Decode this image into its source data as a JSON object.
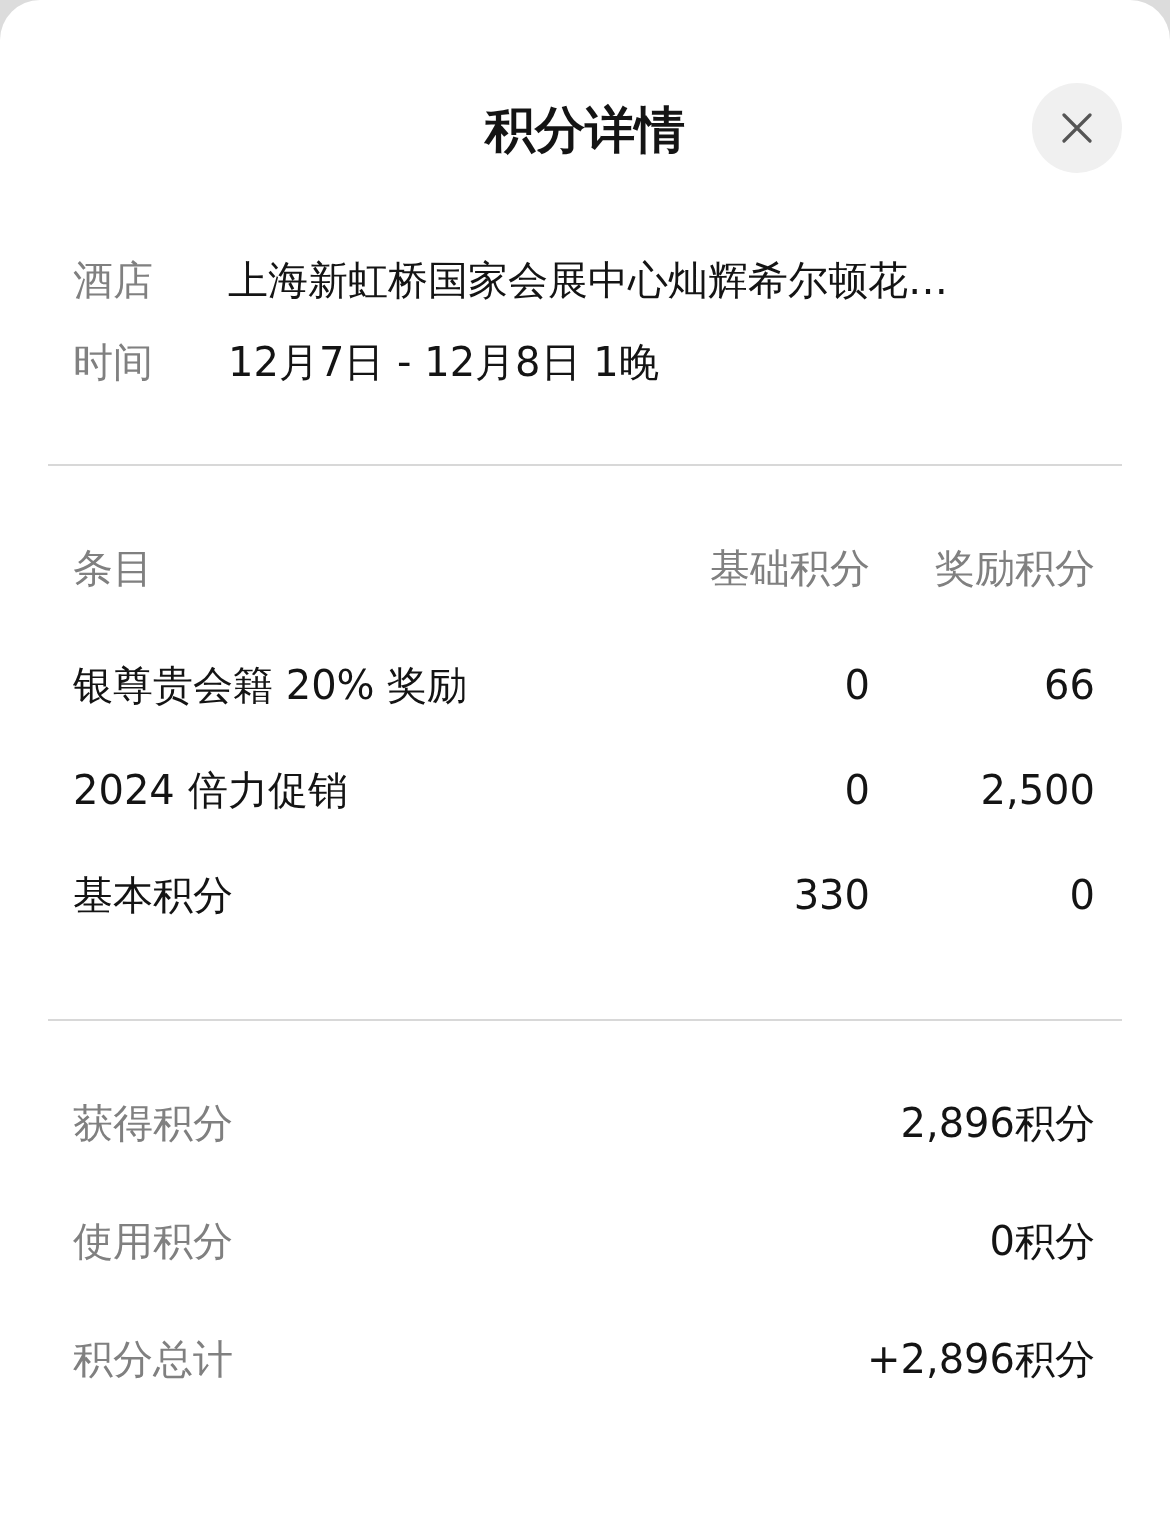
{
  "title": "积分详情",
  "stay": [
    {
      "label": "酒店",
      "value": "上海新虹桥国家会展中心灿辉希尔顿花…"
    },
    {
      "label": "时间",
      "value": "12月7日 - 12月8日 1晚"
    }
  ],
  "table": {
    "columns": [
      "条目",
      "基础积分",
      "奖励积分"
    ],
    "rows": [
      [
        "银尊贵会籍 20% 奖励",
        "0",
        "66"
      ],
      [
        "2024 倍力促销",
        "0",
        "2,500"
      ],
      [
        "基本积分",
        "330",
        "0"
      ]
    ]
  },
  "summary": [
    {
      "label": "获得积分",
      "value": "2,896积分"
    },
    {
      "label": "使用积分",
      "value": "0积分"
    },
    {
      "label": "积分总计",
      "value": "+2,896积分"
    }
  ]
}
